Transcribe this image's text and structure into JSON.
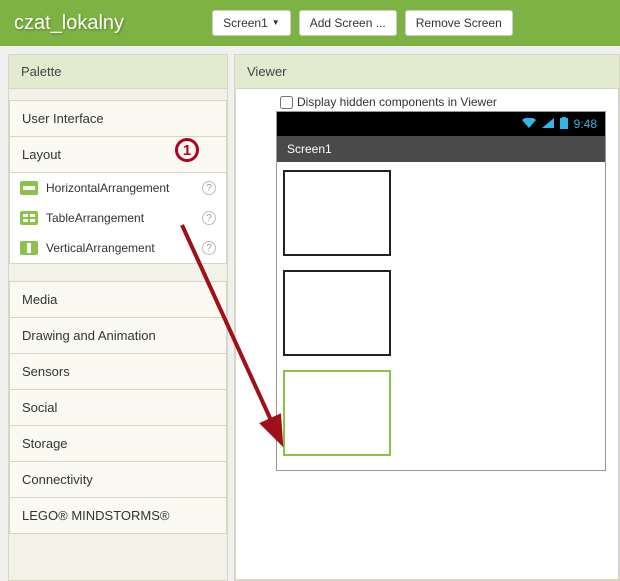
{
  "header": {
    "project": "czat_lokalny",
    "screen_selector": "Screen1",
    "add_screen": "Add Screen ...",
    "remove_screen": "Remove Screen"
  },
  "palette": {
    "title": "Palette",
    "sections": {
      "ui": "User Interface",
      "layout": "Layout",
      "media": "Media",
      "drawing": "Drawing and Animation",
      "sensors": "Sensors",
      "social": "Social",
      "storage": "Storage",
      "connectivity": "Connectivity",
      "lego": "LEGO® MINDSTORMS®"
    },
    "layout_items": {
      "horizontal": "HorizontalArrangement",
      "table": "TableArrangement",
      "vertical": "VerticalArrangement"
    }
  },
  "viewer": {
    "title": "Viewer",
    "display_hidden": "Display hidden components in Viewer",
    "status_time": "9:48",
    "screen_title": "Screen1"
  },
  "annotation": {
    "marker1": "1"
  }
}
